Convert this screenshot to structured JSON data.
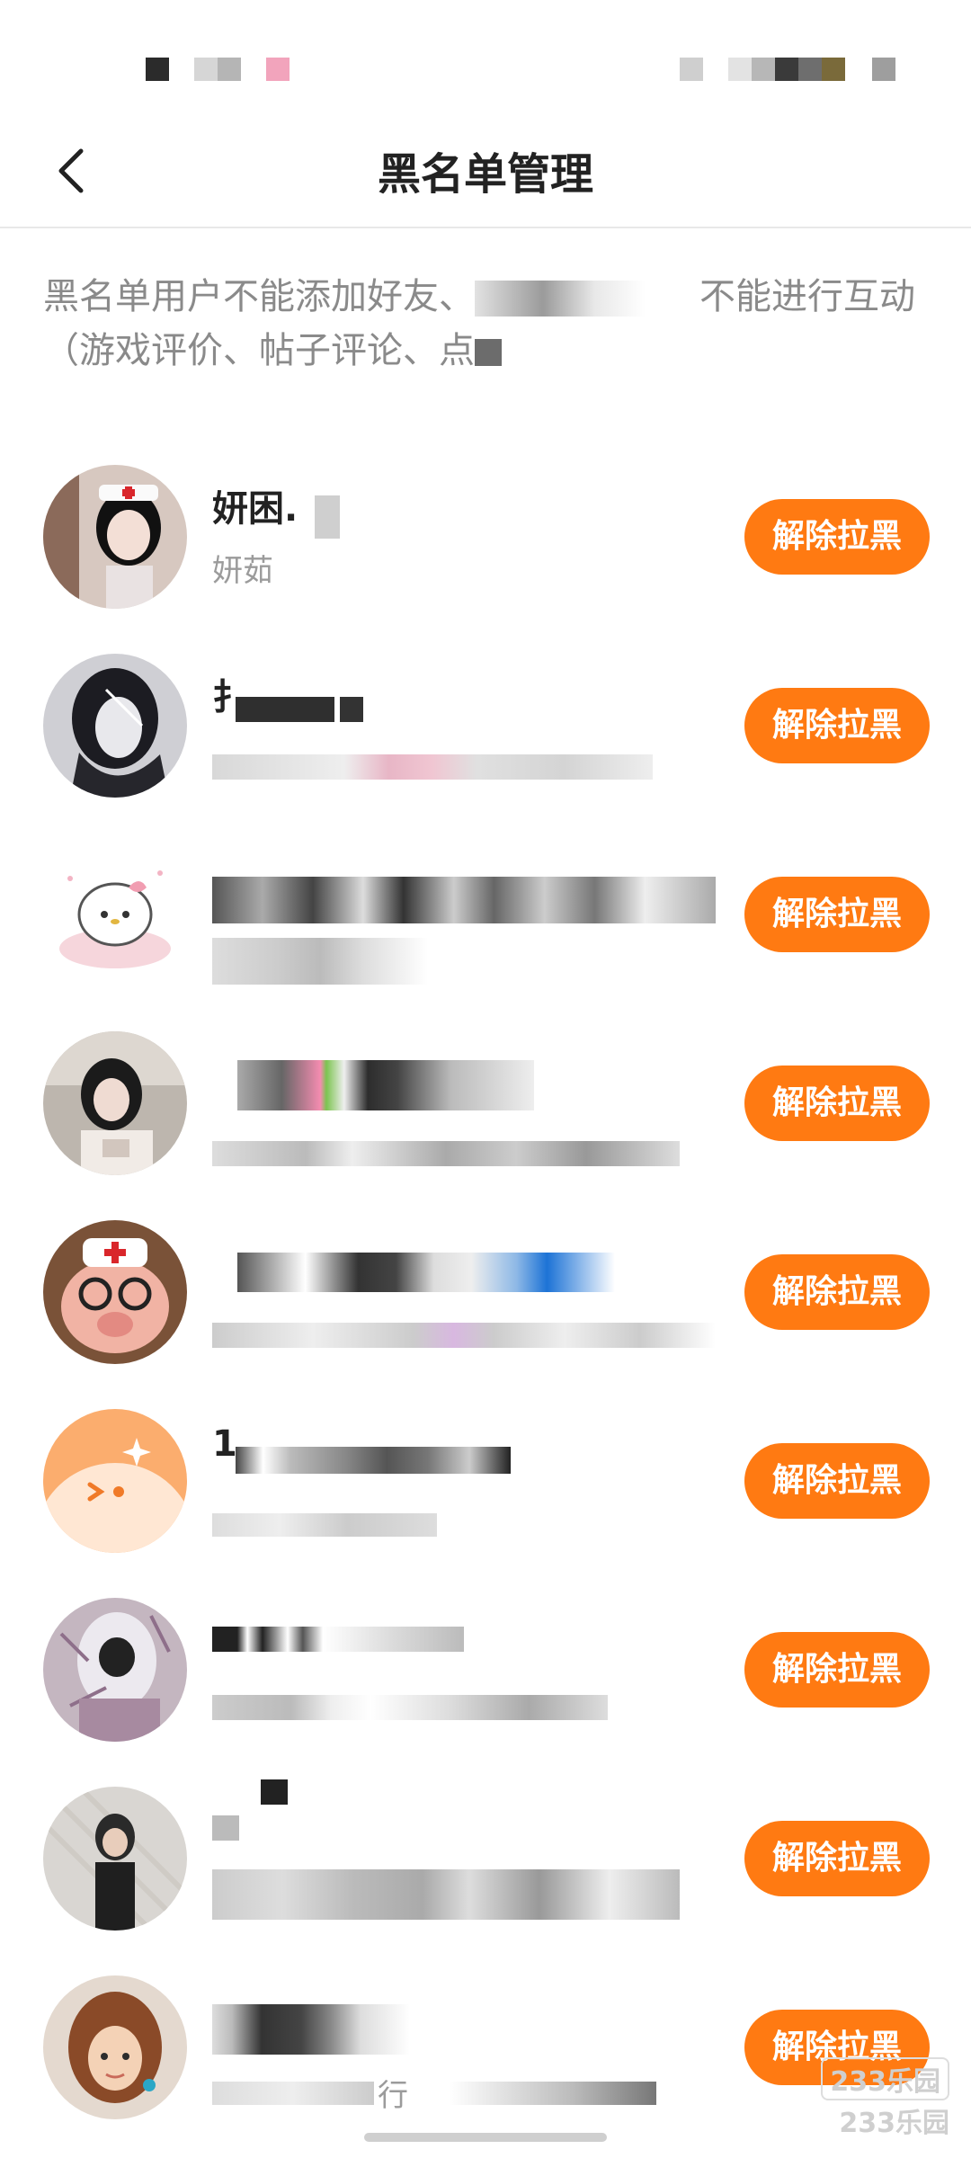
{
  "header": {
    "title": "黑名单管理"
  },
  "description": {
    "line1": "黑名单用户不能添加好友、",
    "line1_tail": "不能进行互动",
    "line2": "（游戏评价、帖子评论、点"
  },
  "unblock_label": "解除拉黑",
  "users": [
    {
      "name": "妍困.",
      "sub": "妍茹"
    },
    {
      "name": "扌",
      "sub": ""
    },
    {
      "name": "",
      "sub": ""
    },
    {
      "name": "",
      "sub": ""
    },
    {
      "name": "",
      "sub": ""
    },
    {
      "name": "1",
      "sub": ""
    },
    {
      "name": "",
      "sub": ""
    },
    {
      "name": "",
      "sub": ""
    },
    {
      "name": "",
      "sub": "行"
    }
  ],
  "watermark": {
    "line1": "233乐园",
    "line2": "233乐园"
  },
  "colors": {
    "accent": "#ff7a12",
    "title": "#222222",
    "muted": "#9b9b9b"
  }
}
